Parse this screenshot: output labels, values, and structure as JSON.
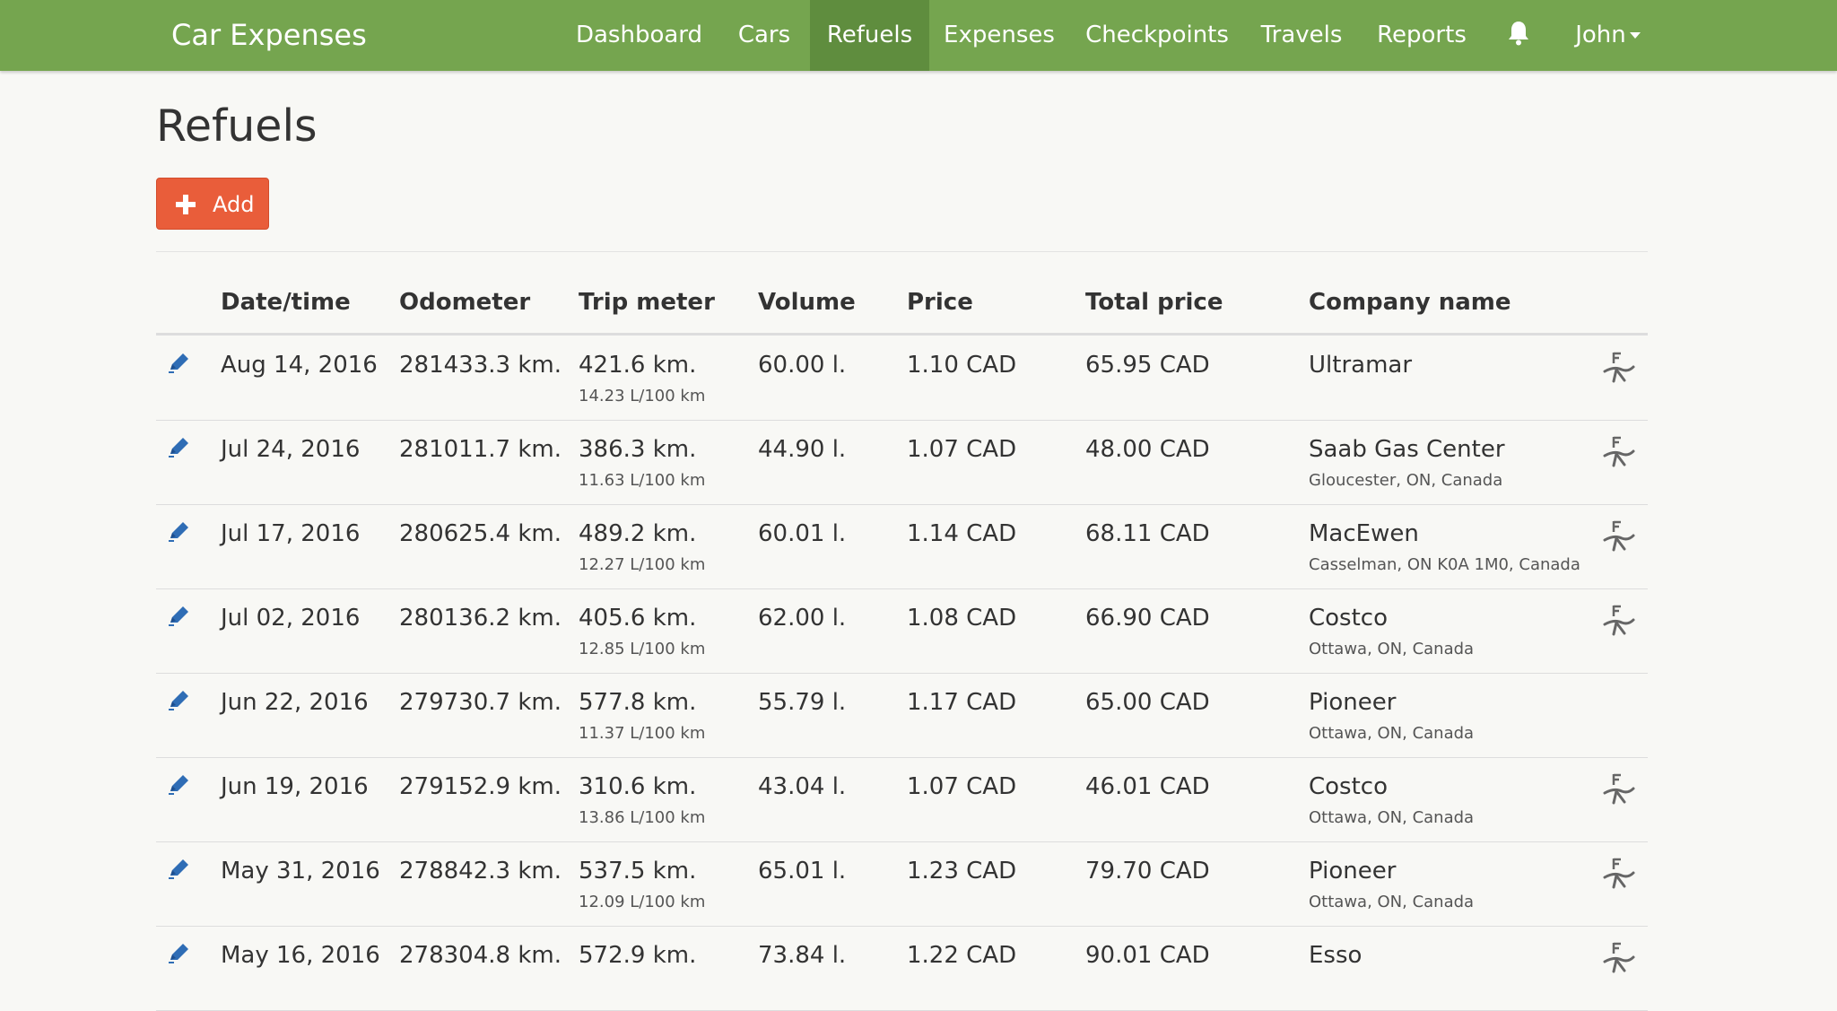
{
  "app": {
    "brand": "Car Expenses"
  },
  "nav": {
    "items": [
      "Dashboard",
      "Cars",
      "Refuels",
      "Expenses",
      "Checkpoints",
      "Travels",
      "Reports"
    ],
    "active": "Refuels",
    "user": "John"
  },
  "page": {
    "title": "Refuels",
    "add_label": "Add"
  },
  "table": {
    "headers": [
      "Date/time",
      "Odometer",
      "Trip meter",
      "Volume",
      "Price",
      "Total price",
      "Company name"
    ],
    "rows": [
      {
        "date": "Aug 14, 2016",
        "odometer": "281433.3 km.",
        "trip": "421.6 km.",
        "consumption": "14.23 L/100 km",
        "volume": "60.00 l.",
        "price": "1.10 CAD",
        "total": "65.95 CAD",
        "company": "Ultramar",
        "location": "",
        "full_tank": true
      },
      {
        "date": "Jul 24, 2016",
        "odometer": "281011.7 km.",
        "trip": "386.3 km.",
        "consumption": "11.63 L/100 km",
        "volume": "44.90 l.",
        "price": "1.07 CAD",
        "total": "48.00 CAD",
        "company": "Saab Gas Center",
        "location": "Gloucester, ON, Canada",
        "full_tank": true
      },
      {
        "date": "Jul 17, 2016",
        "odometer": "280625.4 km.",
        "trip": "489.2 km.",
        "consumption": "12.27 L/100 km",
        "volume": "60.01 l.",
        "price": "1.14 CAD",
        "total": "68.11 CAD",
        "company": "MacEwen",
        "location": "Casselman, ON K0A 1M0, Canada",
        "full_tank": true
      },
      {
        "date": "Jul 02, 2016",
        "odometer": "280136.2 km.",
        "trip": "405.6 km.",
        "consumption": "12.85 L/100 km",
        "volume": "62.00 l.",
        "price": "1.08 CAD",
        "total": "66.90 CAD",
        "company": "Costco",
        "location": "Ottawa, ON, Canada",
        "full_tank": true
      },
      {
        "date": "Jun 22, 2016",
        "odometer": "279730.7 km.",
        "trip": "577.8 km.",
        "consumption": "11.37 L/100 km",
        "volume": "55.79 l.",
        "price": "1.17 CAD",
        "total": "65.00 CAD",
        "company": "Pioneer",
        "location": "Ottawa, ON, Canada",
        "full_tank": false
      },
      {
        "date": "Jun 19, 2016",
        "odometer": "279152.9 km.",
        "trip": "310.6 km.",
        "consumption": "13.86 L/100 km",
        "volume": "43.04 l.",
        "price": "1.07 CAD",
        "total": "46.01 CAD",
        "company": "Costco",
        "location": "Ottawa, ON, Canada",
        "full_tank": true
      },
      {
        "date": "May 31, 2016",
        "odometer": "278842.3 km.",
        "trip": "537.5 km.",
        "consumption": "12.09 L/100 km",
        "volume": "65.01 l.",
        "price": "1.23 CAD",
        "total": "79.70 CAD",
        "company": "Pioneer",
        "location": "Ottawa, ON, Canada",
        "full_tank": true
      },
      {
        "date": "May 16, 2016",
        "odometer": "278304.8 km.",
        "trip": "572.9 km.",
        "consumption": "",
        "volume": "73.84 l.",
        "price": "1.22 CAD",
        "total": "90.01 CAD",
        "company": "Esso",
        "location": "",
        "full_tank": true
      }
    ]
  },
  "icons": {
    "edit": "pencil-icon",
    "full_tank": "fuel-pump-icon",
    "notifications": "bell-icon",
    "add": "plus-icon"
  },
  "colors": {
    "navbar": "#75a54f",
    "navbar_active": "#5f8d3e",
    "add_button": "#e95d3a",
    "edit_icon": "#2f6db5"
  }
}
